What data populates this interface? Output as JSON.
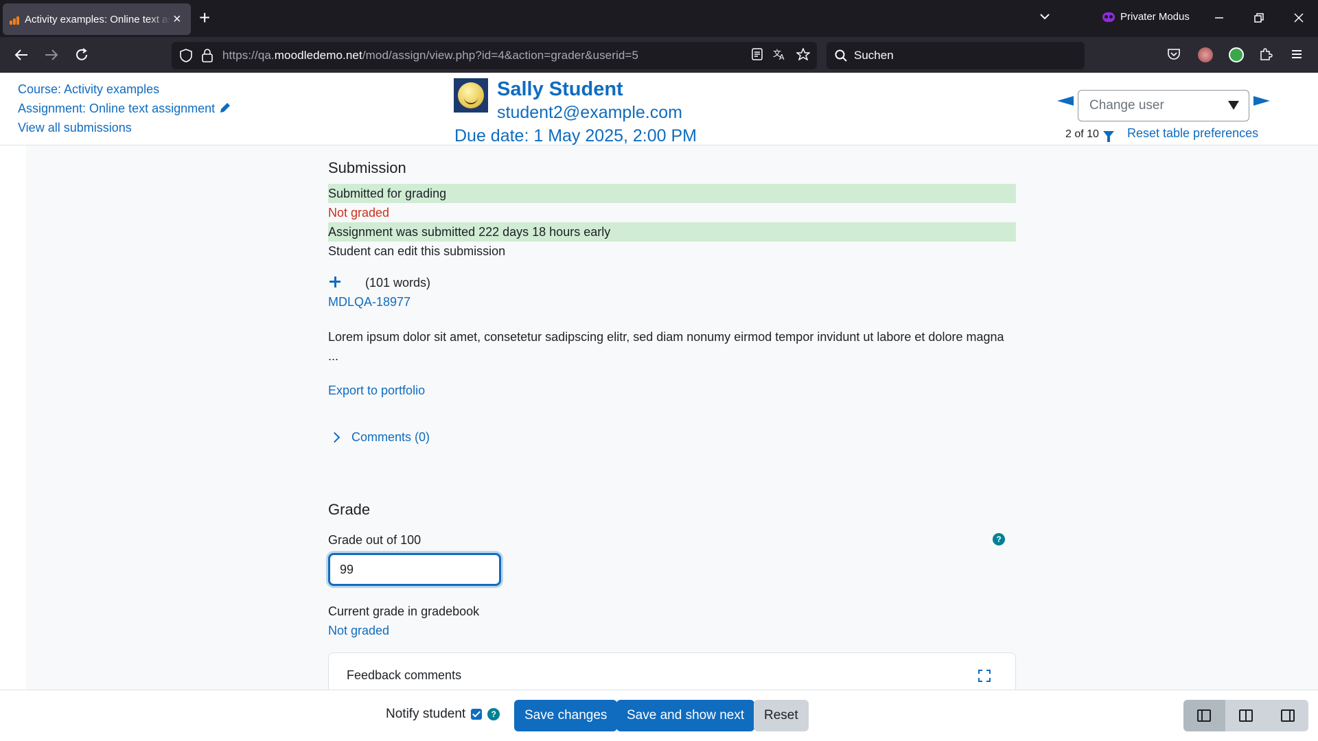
{
  "browser": {
    "tab_title": "Activity examples: Online text assignment",
    "new_tab": "+",
    "private_mode": "Privater Modus",
    "url_prefix": "https://qa.",
    "url_domain": "moodledemo.net",
    "url_path": "/mod/assign/view.php?id=4&action=grader&userid=5",
    "search_placeholder": "Suchen"
  },
  "header": {
    "course_link": "Course: Activity examples",
    "assignment_link": "Assignment: Online text assignment",
    "view_all_link": "View all submissions",
    "user_name": "Sally Student",
    "user_email": "student2@example.com",
    "due_date": "Due date: 1 May 2025, 2:00 PM",
    "change_user_placeholder": "Change user",
    "counter": "2 of 10",
    "reset_prefs": "Reset table preferences"
  },
  "submission": {
    "heading": "Submission",
    "status_submitted": "Submitted for grading",
    "status_grading": "Not graded",
    "time_status": "Assignment was submitted 222 days 18 hours early",
    "edit_status": "Student can edit this submission",
    "word_count": "(101 words)",
    "title_link": "MDLQA-18977",
    "text": "Lorem ipsum dolor sit amet, consetetur sadipscing elitr, sed diam nonumy eirmod tempor invidunt ut labore et dolore magna ...",
    "export_link": "Export to portfolio",
    "comments_link": "Comments (0)"
  },
  "grade": {
    "heading": "Grade",
    "label": "Grade out of 100",
    "value": "99",
    "current_label": "Current grade in gradebook",
    "current_value": "Not graded",
    "feedback_label": "Feedback comments"
  },
  "footer": {
    "notify_label": "Notify student",
    "notify_checked": true,
    "save_label": "Save changes",
    "save_next_label": "Save and show next",
    "reset_label": "Reset"
  },
  "colors": {
    "link": "#0f6cbf",
    "success_bg": "#d1ecd4",
    "danger": "#ca3120",
    "help": "#008196"
  }
}
